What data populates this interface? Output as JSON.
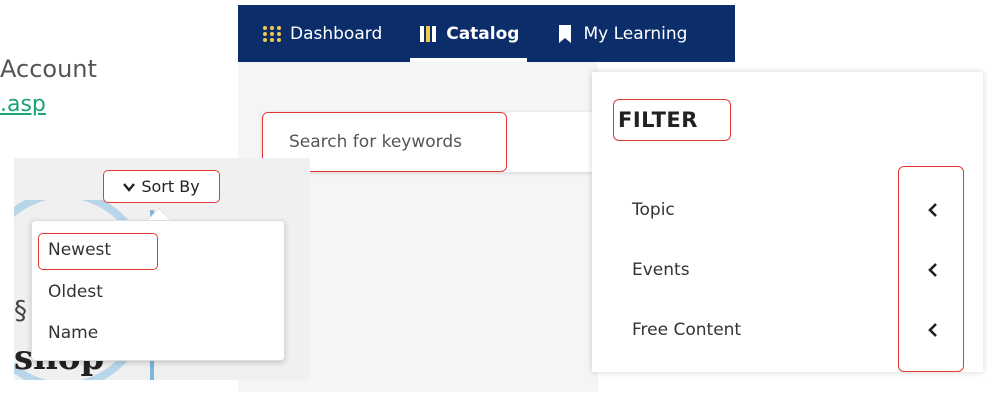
{
  "fragments": {
    "account_text": "Account",
    "link_text": ".asp"
  },
  "nav": {
    "items": [
      {
        "label": "Dashboard",
        "icon": "grid-dots-icon"
      },
      {
        "label": "Catalog",
        "icon": "book-icon",
        "active": true
      },
      {
        "label": "My Learning",
        "icon": "bookmark-icon"
      }
    ]
  },
  "search": {
    "placeholder": "Search for keywords"
  },
  "filter": {
    "title": "FILTER",
    "items": [
      "Topic",
      "Events",
      "Free Content"
    ]
  },
  "sort": {
    "button_label": "Sort By",
    "options": [
      "Newest",
      "Oldest",
      "Name"
    ],
    "selected": "Newest"
  },
  "background_image": {
    "visible_word": "shop"
  },
  "colors": {
    "nav_bg": "#0b2e6b",
    "highlight": "#e53935",
    "link": "#1aa37a"
  }
}
